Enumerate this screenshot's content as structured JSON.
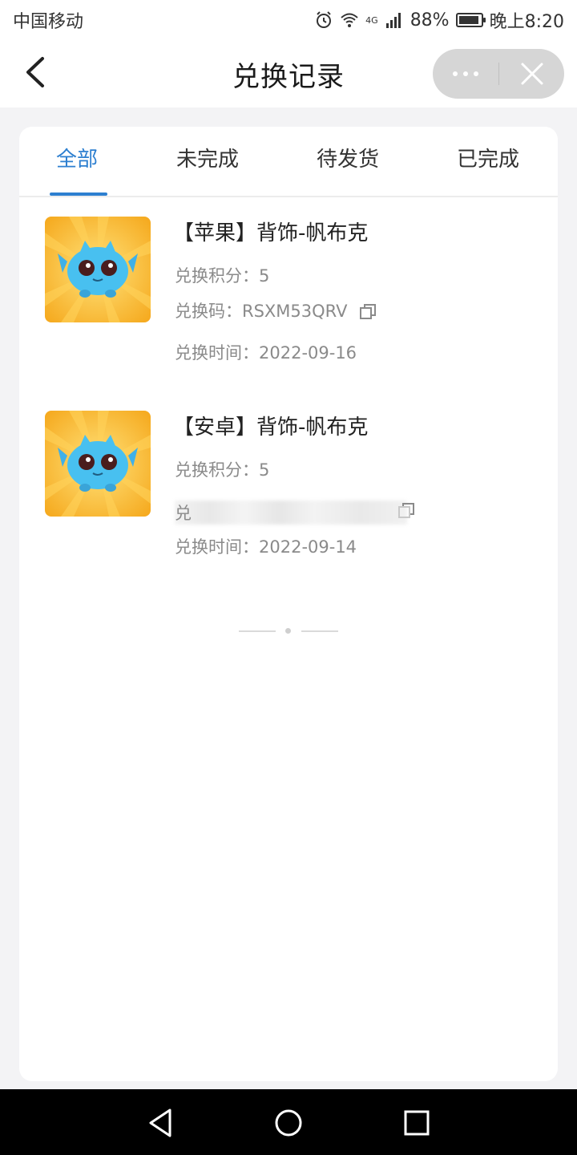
{
  "status_bar": {
    "carrier": "中国移动",
    "network": "4G",
    "battery": "88%",
    "time": "晚上8:20"
  },
  "header": {
    "title": "兑换记录",
    "back_icon": "chevron-left-icon",
    "more_icon": "more-dots-icon",
    "close_icon": "close-icon"
  },
  "tabs": [
    {
      "label": "全部",
      "active": true
    },
    {
      "label": "未完成",
      "active": false
    },
    {
      "label": "待发货",
      "active": false
    },
    {
      "label": "已完成",
      "active": false
    }
  ],
  "records": [
    {
      "title": "【苹果】背饰-帆布克",
      "points_label": "兑换积分：5",
      "code_label": "兑换码：RSXM53QRV",
      "time_label": "兑换时间：2022-09-16"
    },
    {
      "title": "【安卓】背饰-帆布克",
      "points_label": "兑换积分：5",
      "code_prefix": "兑",
      "time_label": "兑换时间：2022-09-14"
    }
  ],
  "colors": {
    "accent": "#2d7fd0",
    "meta_text": "#8a8a8a",
    "background": "#f3f3f5"
  }
}
